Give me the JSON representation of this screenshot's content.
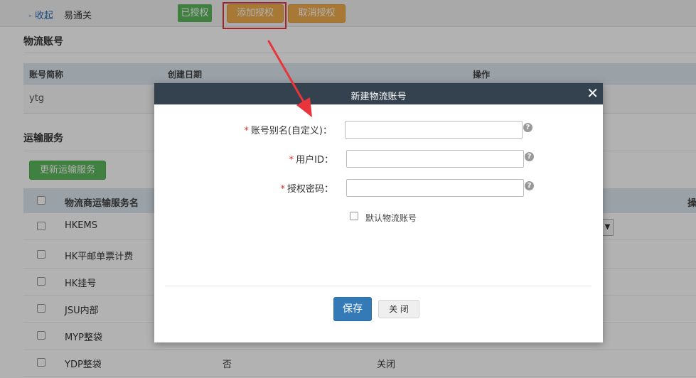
{
  "top_row": {
    "collapse_link": "- 收起",
    "platform_name": "易通关",
    "status_badge": "已授权",
    "add_auth_button": "添加授权",
    "cancel_auth_button": "取消授权"
  },
  "logistics_section": {
    "title": "物流账号",
    "columns": [
      "账号简称",
      "创建日期",
      "操作"
    ],
    "rows": [
      {
        "name": "ytg"
      }
    ]
  },
  "transport_section": {
    "title": "运输服务",
    "update_button": "更新运输服务",
    "header_name": "物流商运输服务名",
    "header_op": "操",
    "select_arrow": "▼",
    "rows": [
      {
        "name": "HKEMS",
        "col2": "",
        "col3": ""
      },
      {
        "name": "HK平邮单票计费",
        "col2": "",
        "col3": ""
      },
      {
        "name": "HK挂号",
        "col2": "",
        "col3": ""
      },
      {
        "name": "JSU内部",
        "col2": "",
        "col3": ""
      },
      {
        "name": "MYP整袋",
        "col2": "",
        "col3": ""
      },
      {
        "name": "YDP整袋",
        "col2": "否",
        "col3": "关闭"
      }
    ]
  },
  "modal": {
    "title": "新建物流账号",
    "close_glyph": "✕",
    "required_mark": "*",
    "help_glyph": "?",
    "fields": [
      {
        "label": "账号别名(自定义)：",
        "value": "",
        "placeholder": ""
      },
      {
        "label": "用户ID：",
        "value": "",
        "placeholder": ""
      },
      {
        "label": "授权密码：",
        "value": "",
        "placeholder": ""
      }
    ],
    "default_checkbox_label": "默认物流账号",
    "save_button": "保存",
    "close_button": "关 闭"
  },
  "colors": {
    "modal_header": "#34414f",
    "primary_blue": "#337ab7",
    "annotation_red": "#e8343a",
    "orange": "#f0ad4e",
    "green": "#5cb85c"
  }
}
